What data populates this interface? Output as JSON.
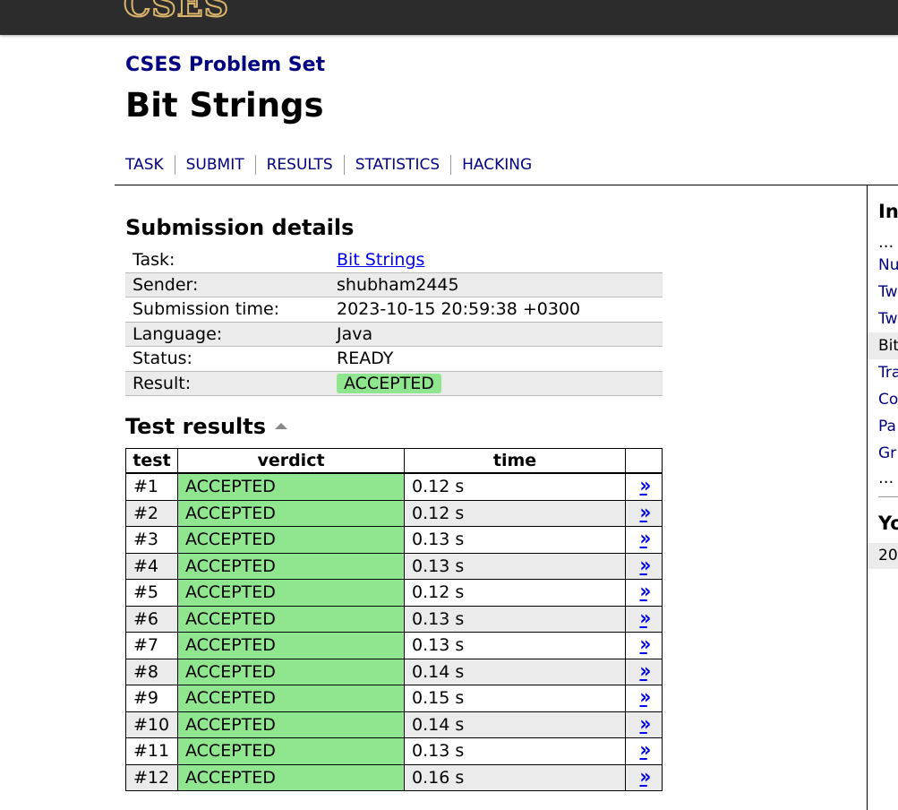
{
  "header": {
    "logo_text": "CSES"
  },
  "problem_set_title": "CSES Problem Set",
  "page_title": "Bit Strings",
  "nav": [
    "TASK",
    "SUBMIT",
    "RESULTS",
    "STATISTICS",
    "HACKING"
  ],
  "submission": {
    "heading": "Submission details",
    "rows": [
      {
        "key": "Task:",
        "value": "Bit Strings"
      },
      {
        "key": "Sender:",
        "value": "shubham2445"
      },
      {
        "key": "Submission time:",
        "value": "2023-10-15 20:59:38 +0300"
      },
      {
        "key": "Language:",
        "value": "Java"
      },
      {
        "key": "Status:",
        "value": "READY"
      },
      {
        "key": "Result:",
        "value": "ACCEPTED"
      }
    ]
  },
  "tests": {
    "heading": "Test results",
    "columns": [
      "test",
      "verdict",
      "time",
      ""
    ],
    "link_glyph": "»",
    "rows": [
      {
        "test": "#1",
        "verdict": "ACCEPTED",
        "time": "0.12 s"
      },
      {
        "test": "#2",
        "verdict": "ACCEPTED",
        "time": "0.12 s"
      },
      {
        "test": "#3",
        "verdict": "ACCEPTED",
        "time": "0.13 s"
      },
      {
        "test": "#4",
        "verdict": "ACCEPTED",
        "time": "0.13 s"
      },
      {
        "test": "#5",
        "verdict": "ACCEPTED",
        "time": "0.12 s"
      },
      {
        "test": "#6",
        "verdict": "ACCEPTED",
        "time": "0.13 s"
      },
      {
        "test": "#7",
        "verdict": "ACCEPTED",
        "time": "0.13 s"
      },
      {
        "test": "#8",
        "verdict": "ACCEPTED",
        "time": "0.14 s"
      },
      {
        "test": "#9",
        "verdict": "ACCEPTED",
        "time": "0.15 s"
      },
      {
        "test": "#10",
        "verdict": "ACCEPTED",
        "time": "0.14 s"
      },
      {
        "test": "#11",
        "verdict": "ACCEPTED",
        "time": "0.13 s"
      },
      {
        "test": "#12",
        "verdict": "ACCEPTED",
        "time": "0.16 s"
      }
    ]
  },
  "sidebar": {
    "title": "In",
    "dots_top": "...",
    "items": [
      {
        "label": "Nu",
        "current": false
      },
      {
        "label": "Tw",
        "current": false
      },
      {
        "label": "Tw",
        "current": false
      },
      {
        "label": "Bit",
        "current": true
      },
      {
        "label": "Tra",
        "current": false
      },
      {
        "label": "Co",
        "current": false
      },
      {
        "label": "Pa",
        "current": false
      },
      {
        "label": "Gr",
        "current": false
      }
    ],
    "dots_bottom": "...",
    "title2": "Yo",
    "cell": "20"
  },
  "colors": {
    "accepted_bg": "#8fe68f",
    "link": "#0000ee",
    "nav": "#000080",
    "topbar": "#2c2c2c"
  }
}
